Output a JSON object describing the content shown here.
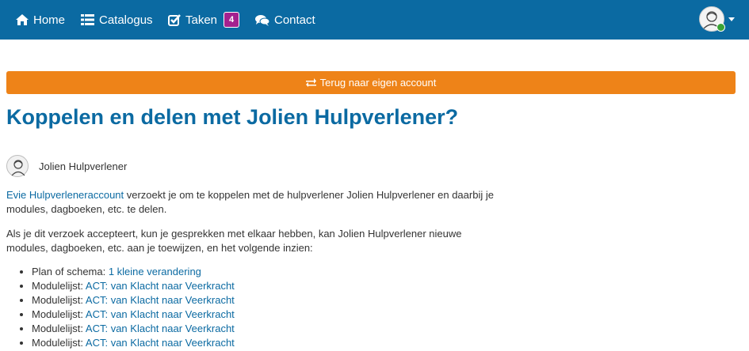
{
  "nav": {
    "home": "Home",
    "catalogus": "Catalogus",
    "taken": "Taken",
    "taken_count": "4",
    "contact": "Contact"
  },
  "back_button": "Terug naar eigen account",
  "page_title": "Koppelen en delen met Jolien Hulpverlener?",
  "person_name": "Jolien Hulpverlener",
  "intro": {
    "link": "Evie Hulpverleneraccount",
    "text": " verzoekt je om te koppelen met de hulpverlener Jolien Hulpverlener en daarbij je modules, dagboeken, etc. te delen."
  },
  "accept_text": "Als je dit verzoek accepteert, kun je gesprekken met elkaar hebben, kan Jolien Hulpverlener nieuwe modules, dagboeken, etc. aan je toewijzen, en het volgende inzien:",
  "items": [
    {
      "prefix": "Plan of schema: ",
      "link": "1 kleine verandering"
    },
    {
      "prefix": "Modulelijst: ",
      "link": "ACT: van Klacht naar Veerkracht"
    },
    {
      "prefix": "Modulelijst: ",
      "link": "ACT: van Klacht naar Veerkracht"
    },
    {
      "prefix": "Modulelijst: ",
      "link": "ACT: van Klacht naar Veerkracht"
    },
    {
      "prefix": "Modulelijst: ",
      "link": "ACT: van Klacht naar Veerkracht"
    },
    {
      "prefix": "Modulelijst: ",
      "link": "ACT: van Klacht naar Veerkracht"
    }
  ],
  "colors": {
    "navbar": "#0b6aa2",
    "accent_orange": "#ee8318",
    "badge": "#a3218f",
    "link": "#0b6aa2",
    "online": "#3aa435"
  }
}
